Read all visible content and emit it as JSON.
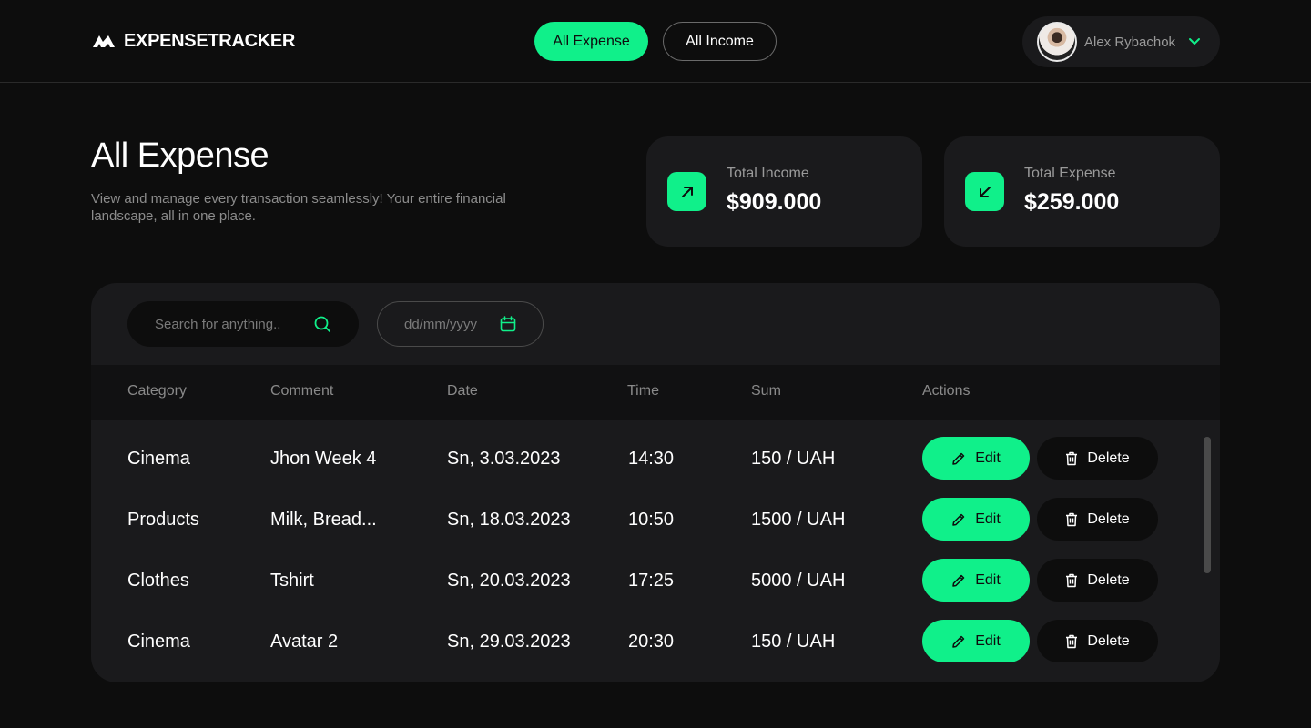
{
  "header": {
    "logo_text": "EXPENSETRACKER",
    "nav": {
      "expense_label": "All Expense",
      "income_label": "All  Income"
    },
    "user": {
      "name": "Alex Rybachok"
    }
  },
  "page": {
    "title": "All Expense",
    "description": "View and manage every transaction seamlessly! Your entire financial landscape, all in one place."
  },
  "stats": {
    "income": {
      "label": "Total Income",
      "value": "$909.000"
    },
    "expense": {
      "label": "Total  Expense",
      "value": "$259.000"
    }
  },
  "filters": {
    "search_placeholder": "Search for anything..",
    "date_placeholder": "dd/mm/yyyy"
  },
  "table": {
    "columns": [
      "Category",
      "Comment",
      "Date",
      "Time",
      "Sum",
      "Actions"
    ],
    "rows": [
      {
        "category": "Cinema",
        "comment": "Jhon Week 4",
        "date": "Sn, 3.03.2023",
        "time": "14:30",
        "sum": "150 / UAH"
      },
      {
        "category": "Products",
        "comment": "Milk, Bread...",
        "date": "Sn, 18.03.2023",
        "time": "10:50",
        "sum": "1500 / UAH"
      },
      {
        "category": "Clothes",
        "comment": "Tshirt",
        "date": "Sn, 20.03.2023",
        "time": "17:25",
        "sum": "5000 / UAH"
      },
      {
        "category": "Cinema",
        "comment": "Avatar 2",
        "date": "Sn, 29.03.2023",
        "time": "20:30",
        "sum": "150 / UAH"
      }
    ],
    "edit_label": "Edit",
    "delete_label": "Delete"
  },
  "colors": {
    "accent": "#10f08a",
    "background": "#0d0d0d",
    "panel": "#1a1a1c"
  }
}
